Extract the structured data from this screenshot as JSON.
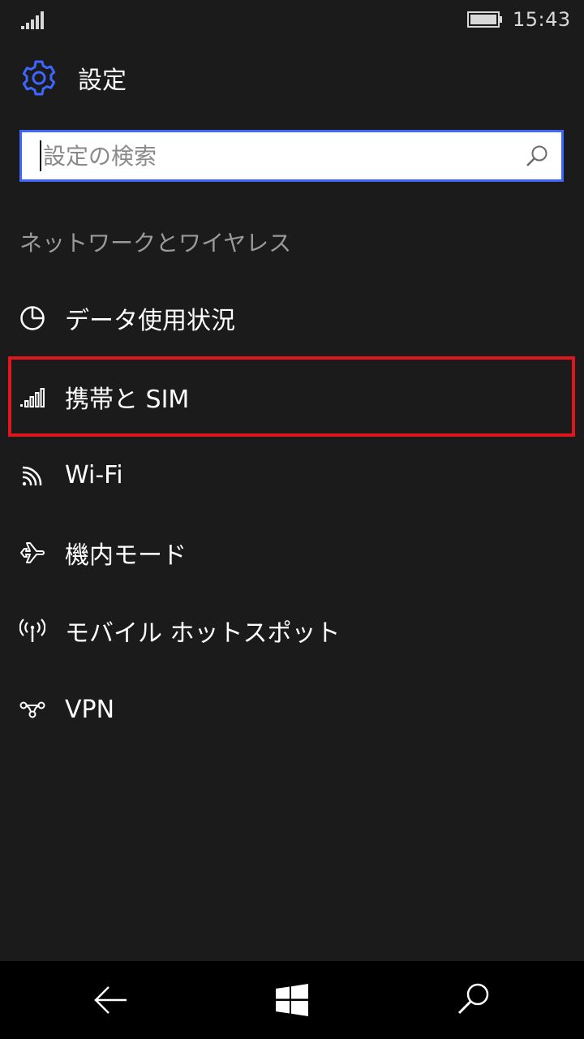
{
  "status": {
    "time": "15:43",
    "icons": [
      "signal-strength-icon",
      "battery-icon"
    ]
  },
  "header": {
    "title": "設定",
    "icon": "gear-icon",
    "accent_color": "#3d66ff"
  },
  "search": {
    "placeholder": "設定の検索",
    "value": "",
    "icon": "search-icon"
  },
  "section": {
    "heading": "ネットワークとワイヤレス"
  },
  "items": [
    {
      "label": "データ使用状況",
      "icon": "data-usage-pie-icon"
    },
    {
      "label": "携帯と SIM",
      "icon": "cellular-signal-icon",
      "highlighted": true,
      "highlight_color": "#e0161f"
    },
    {
      "label": "Wi-Fi",
      "icon": "wifi-icon"
    },
    {
      "label": "機内モード",
      "icon": "airplane-icon"
    },
    {
      "label": "モバイル ホットスポット",
      "icon": "hotspot-icon"
    },
    {
      "label": "VPN",
      "icon": "vpn-icon"
    }
  ],
  "navbar": {
    "buttons": [
      "back-arrow-icon",
      "windows-start-icon",
      "search-icon"
    ]
  }
}
